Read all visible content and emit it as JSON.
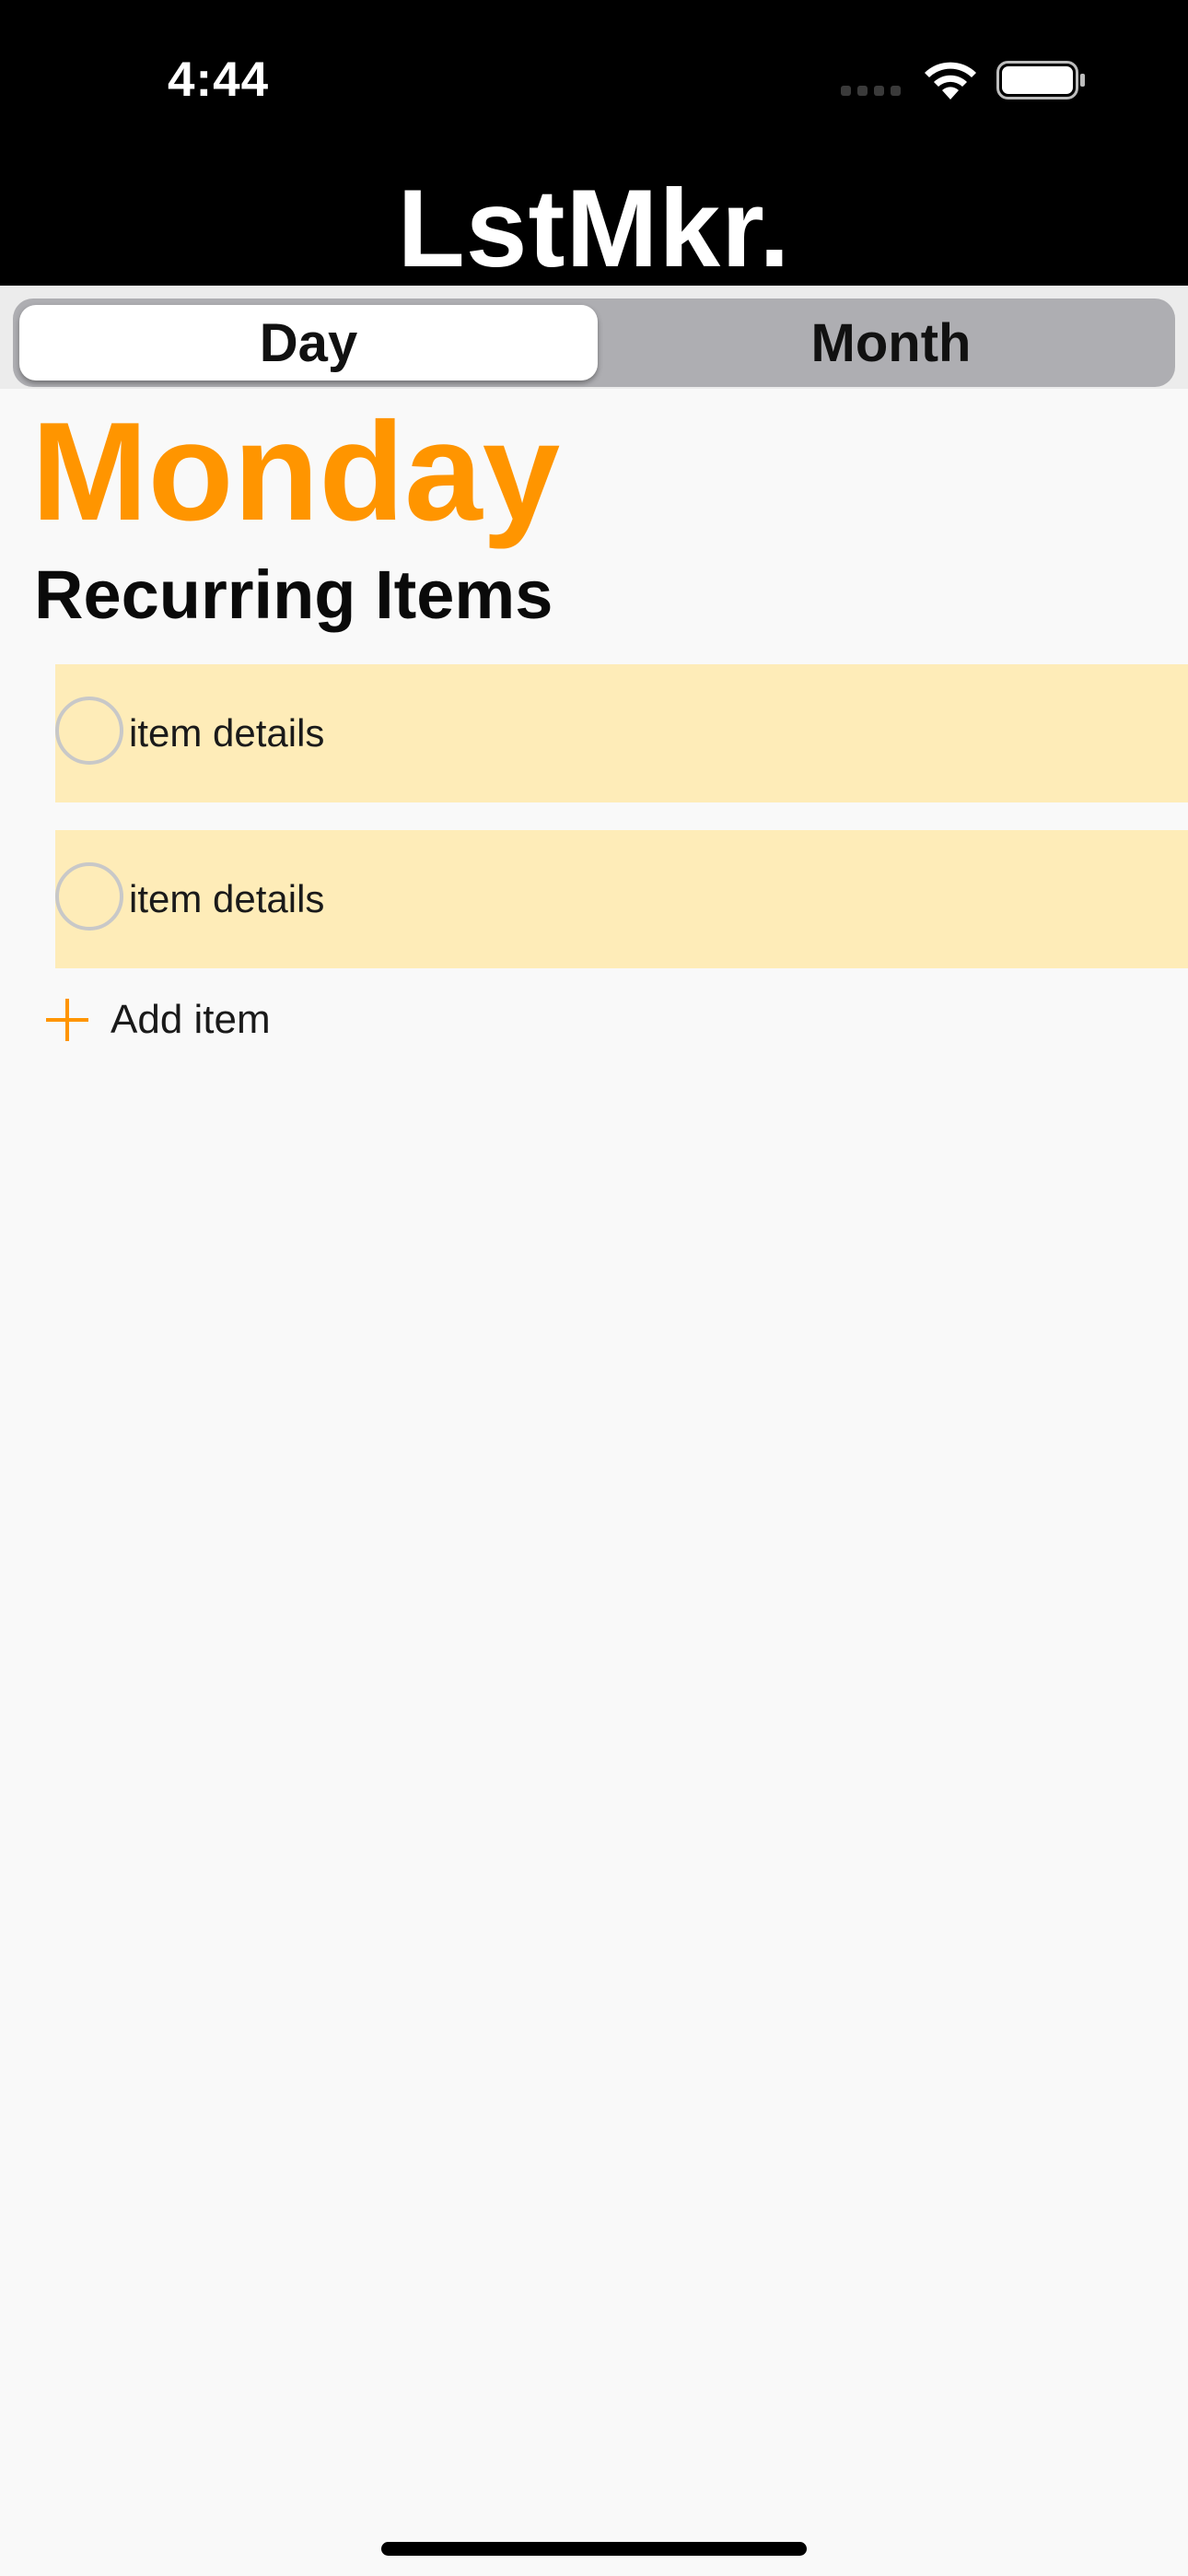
{
  "status_bar": {
    "time": "4:44"
  },
  "app": {
    "title": "LstMkr."
  },
  "segmented_control": {
    "options": [
      "Day",
      "Month"
    ],
    "selected": "Day"
  },
  "main": {
    "day_title": "Monday",
    "section_title": "Recurring Items",
    "items": [
      {
        "label": "item details",
        "checked": false
      },
      {
        "label": "item details",
        "checked": false
      }
    ],
    "add_item_label": "Add item"
  },
  "colors": {
    "accent": "#ff9500",
    "item_background": "#feecb8",
    "header_background": "#000000"
  },
  "icons": {
    "wifi": "wifi-icon",
    "battery": "battery-icon",
    "add": "plus-icon",
    "checkbox": "circle-outline-icon"
  }
}
